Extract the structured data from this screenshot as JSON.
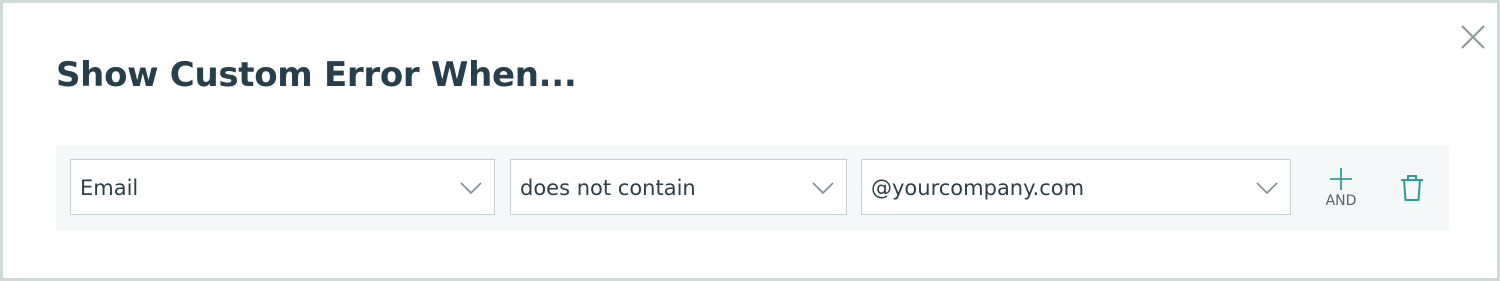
{
  "dialog": {
    "title": "Show Custom Error When..."
  },
  "condition": {
    "field": {
      "selected": "Email"
    },
    "operator": {
      "selected": "does not contain"
    },
    "value": {
      "selected": "@yourcompany.com"
    },
    "add_and_label": "AND"
  },
  "icons": {
    "close": "close-icon",
    "chevron": "chevron-down-icon",
    "add": "plus-icon",
    "delete": "trash-icon"
  },
  "colors": {
    "title": "#263f4c",
    "accent": "#2f9c99",
    "row_background": "#f4f8f8",
    "border": "#cfdad8"
  }
}
